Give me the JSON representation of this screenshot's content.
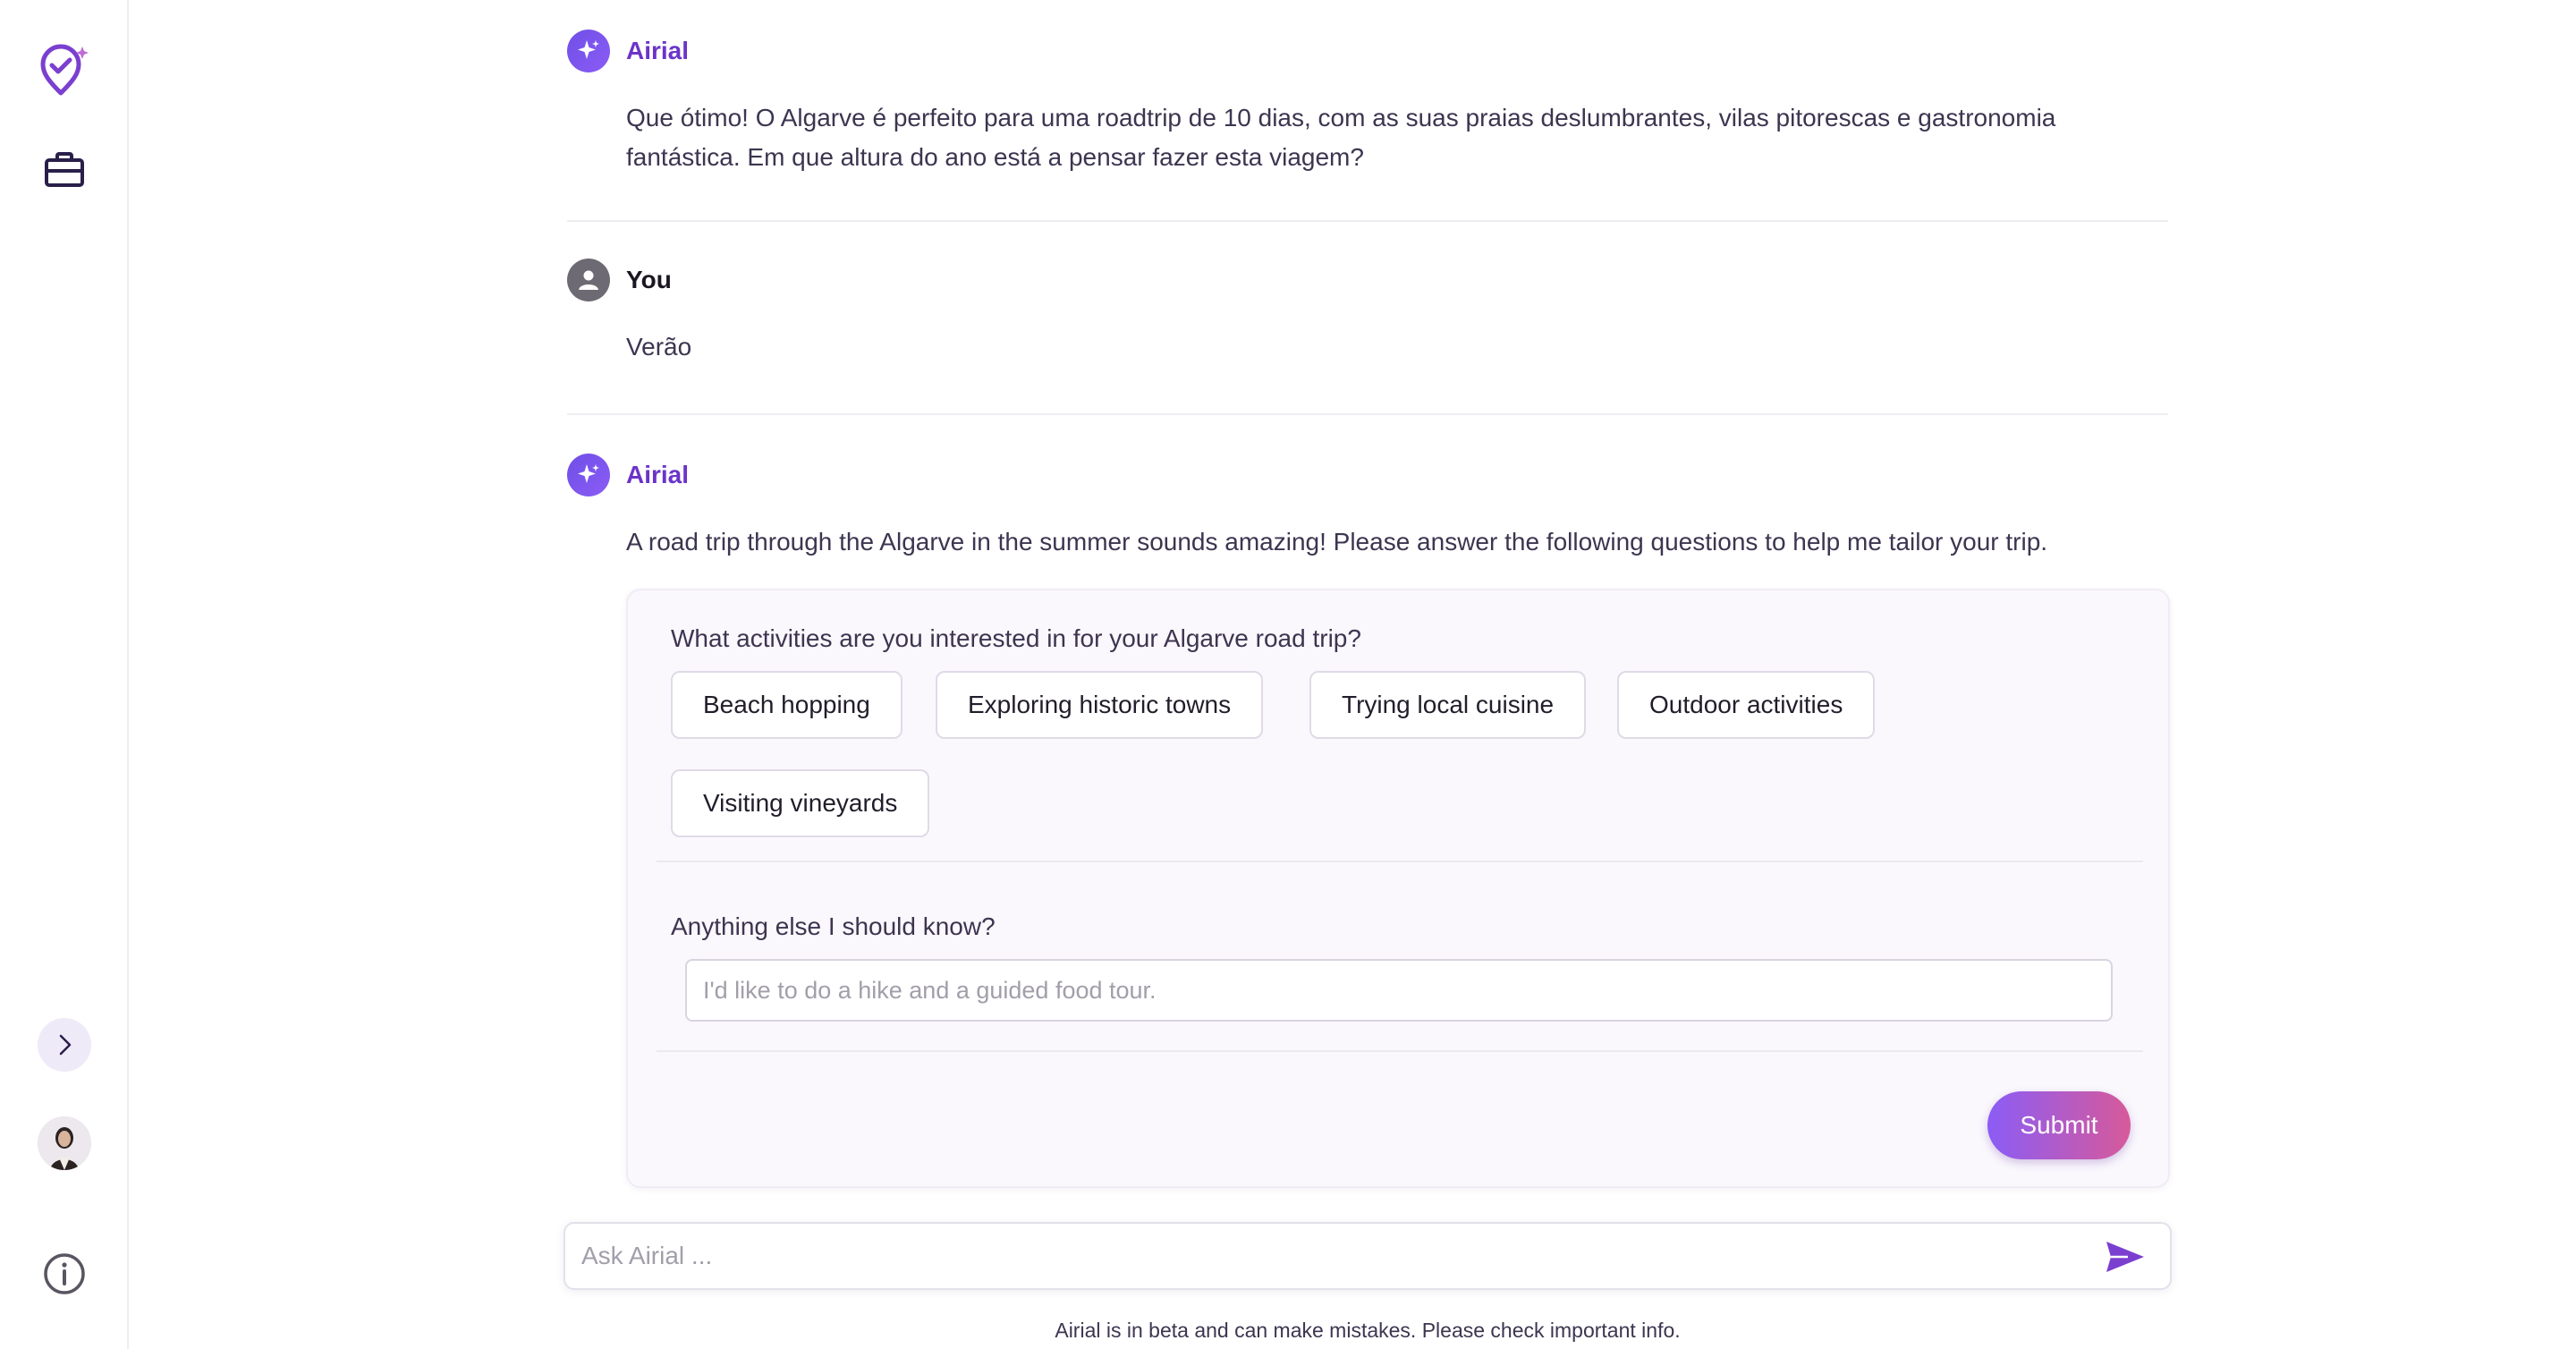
{
  "sidebar": {
    "icons": [
      "location-heart-sparkle-icon",
      "briefcase-icon",
      "chevron-right-icon",
      "avatar",
      "info-icon"
    ]
  },
  "messages": [
    {
      "author": "Airial",
      "role": "ai",
      "text": "Que ótimo! O Algarve é perfeito para uma roadtrip de 10 dias, com as suas praias deslumbrantes, vilas pitorescas e gastronomia fantástica. Em que altura do ano está a pensar fazer esta viagem?"
    },
    {
      "author": "You",
      "role": "user",
      "text": "Verão"
    },
    {
      "author": "Airial",
      "role": "ai",
      "text": "A road trip through the Algarve in the summer sounds amazing! Please answer the following questions to help me tailor your trip."
    }
  ],
  "card": {
    "question": "What activities are you interested in for your Algarve road trip?",
    "options": [
      "Beach hopping",
      "Exploring historic towns",
      "Trying local cuisine",
      "Outdoor activities",
      "Visiting vineyards"
    ],
    "extra_question": "Anything else I should know?",
    "extra_placeholder": "I'd like to do a hike and a guided food tour.",
    "submit_label": "Submit"
  },
  "composer": {
    "placeholder": "Ask Airial ...",
    "disclaimer": "Airial is in beta and can make mistakes. Please check important info."
  },
  "colors": {
    "accent": "#6b34c9",
    "gradient_start": "#8b5cf6",
    "gradient_end": "#d75a9a"
  }
}
